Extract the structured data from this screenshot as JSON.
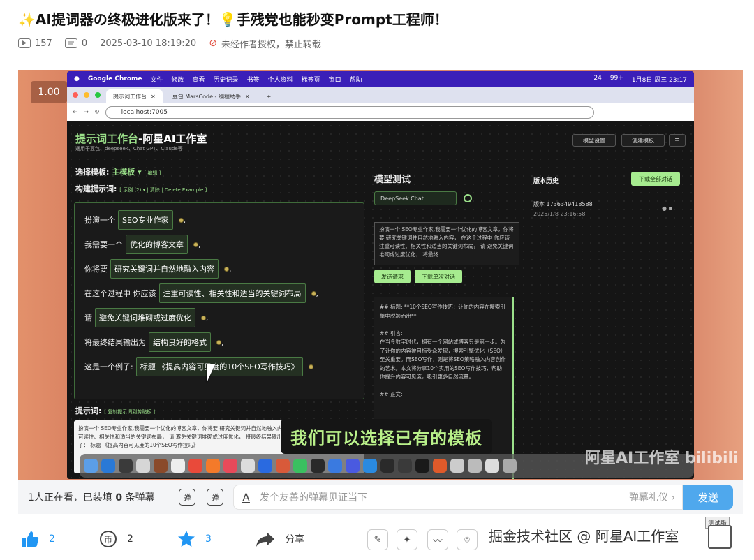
{
  "post": {
    "title": "✨AI提词器の终极进化版来了！💡手残党也能秒变Prompt工程师！",
    "plays": "157",
    "comments": "0",
    "datetime": "2025-03-10 18:19:20",
    "copyright": "未经作者授权，禁止转载"
  },
  "video": {
    "speed": "1.00",
    "subtitle": "我们可以选择已有的模板",
    "watermark": "阿星AI工作室 bilibili",
    "mac_menubar": {
      "items": [
        "Google Chrome",
        "文件",
        "修改",
        "查看",
        "历史记录",
        "书签",
        "个人资料",
        "标签页",
        "窗口",
        "帮助"
      ],
      "status": [
        "24",
        "99+",
        "1月8日 周三  23:17"
      ]
    },
    "browser": {
      "tabs": [
        "提示词工作台",
        "豆包 MarsCode - 编程助手"
      ],
      "url": "localhost:7005"
    },
    "app": {
      "title": "提示词工作台",
      "title_suffix": "-阿星AI工作室",
      "subtitle": "适用于豆包、deepseek、Chat GPT、Claude等",
      "model_settings_btn": "模型设置",
      "create_template_btn": "创建模板",
      "select_template_label": "选择模板:",
      "select_template_value": "主模板 ▾",
      "edit_link": "[ 编辑 ]",
      "build_label": "构建提示词:",
      "build_links": "[ 示例 (2) ▾ | 清除 | Delete Example ]",
      "rows": [
        {
          "prefix": "扮演一个",
          "chip": "SEO专业作家",
          "suffix": ","
        },
        {
          "prefix": "我需要一个",
          "chip": "优化的博客文章",
          "suffix": ","
        },
        {
          "prefix": "你将要",
          "chip": "研究关键词并自然地融入内容",
          "suffix": ","
        },
        {
          "prefix": "在这个过程中 你应该",
          "chip": "注重可读性、相关性和适当的关键词布局",
          "suffix": ","
        },
        {
          "prefix": "请",
          "chip": "避免关键词堆砌或过度优化",
          "suffix": ","
        },
        {
          "prefix": "将最终结果输出为",
          "chip": "结构良好的格式",
          "suffix": ","
        },
        {
          "prefix": "这是一个例子:",
          "chip": "标题 《提高内容可见度的10个SEO写作技巧》",
          "suffix": ""
        }
      ],
      "prompt_label": "提示词:",
      "copy_link": "[ 复制提示词到剪贴板 ]",
      "prompt_text": "扮演一个  SEO专业作家,我需要一个优化的博客文章，你将要  研究关键词并自然地融入内容，  在这个过程中  你应该  注重可读性、相关性和适当的关键词布局，  请  避免关键词堆砌或过度优化，  将最终结果输出为  结构良好的格式，  这是一个例子：  标题 《提高内容可见度的10个SEO写作技巧》",
      "model_test_title": "模型测试",
      "model_select": "DeepSeek Chat",
      "model_input": "扮演一个  SEO专业作家,我需要一个优化的博客文章，你将要  研究关键词并自然地融入内容，  在这个过程中  你应该  注重可读性、相关性和适当的关键词布局，  请  避免关键词堆砌或过度优化，  将最终",
      "send_btn": "发送请求",
      "download_single_btn": "下载单次对话",
      "output_text": "## 标题: **10个SEO写作技巧：让你的内容在搜索引擎中脱颖而出**\n\n## 引言:\n在当今数字时代，拥有一个网站或博客只是第一步。为了让你的内容被目标受众发现，搜索引擎优化（SEO）至关重要。而SEO写作，则是将SEO策略融入内容创作的艺术。本文将分享10个实用的SEO写作技巧，帮助你提升内容可见度，吸引更多自然流量。\n\n## 正文:",
      "history_title": "版本历史",
      "download_all_btn": "下载全部对话",
      "history_version": "版本 1736349418588",
      "history_time": "2025/1/8 23:16:58"
    }
  },
  "danmaku": {
    "viewers_prefix": "1人正在看，已装填",
    "viewers_count": "0",
    "viewers_suffix": "条弹幕",
    "icon1": "弹",
    "icon2": "弹",
    "placeholder": "发个友善的弹幕见证当下",
    "etiquette": "弹幕礼仪 ›",
    "send": "发送"
  },
  "actions": {
    "like": "2",
    "coin": "2",
    "fav": "3",
    "share": "分享"
  },
  "footer": {
    "watermark": "掘金技术社区 @ 阿星AI工作室",
    "badge": "测试版"
  },
  "colors": {
    "accent_blue": "#4fa8ed",
    "app_green": "#9be08a"
  }
}
